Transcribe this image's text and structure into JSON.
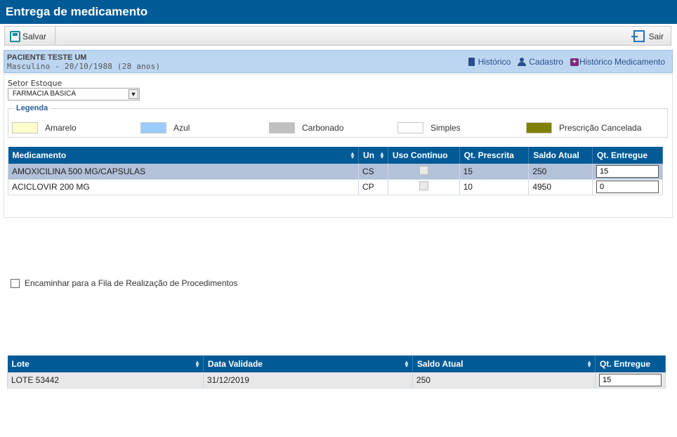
{
  "window": {
    "title": "Entrega de medicamento"
  },
  "toolbar": {
    "save_label": "Salvar",
    "exit_label": "Sair"
  },
  "patient": {
    "name": "PACIENTE TESTE UM",
    "info": "Masculino - 20/10/1988 (28 anos)",
    "links": {
      "historico": "Histórico",
      "cadastro": "Cadastro",
      "historico_medicamento": "Histórico Medicamento"
    }
  },
  "setor": {
    "label": "Setor Estoque",
    "value": "FARMACIA BASICA"
  },
  "legenda": {
    "title": "Legenda",
    "items": [
      {
        "label": "Amarelo",
        "color": "#ffffcc"
      },
      {
        "label": "Azul",
        "color": "#99ccff"
      },
      {
        "label": "Carbonado",
        "color": "#c0c0c0"
      },
      {
        "label": "Simples",
        "color": "#ffffff"
      },
      {
        "label": "Prescrição Cancelada",
        "color": "#808000"
      }
    ]
  },
  "medicamentos": {
    "columns": [
      "Medicamento",
      "Un",
      "Uso Contínuo",
      "Qt. Prescrita",
      "Saldo Atual",
      "Qt. Entregue"
    ],
    "rows": [
      {
        "medicamento": "AMOXICILINA 500 MG/CAPSULAS",
        "un": "CS",
        "qt_prescrita": "15",
        "saldo": "250",
        "qt_entregue": "15"
      },
      {
        "medicamento": "ACICLOVIR 200 MG",
        "un": "CP",
        "qt_prescrita": "10",
        "saldo": "4950",
        "qt_entregue": "0"
      }
    ]
  },
  "encaminhar": {
    "label": "Encaminhar para a Fila de Realização de Procedimentos"
  },
  "lotes": {
    "columns": [
      "Lote",
      "Data Validade",
      "Saldo Atual",
      "Qt. Entregue"
    ],
    "rows": [
      {
        "lote": "LOTE 53442",
        "validade": "31/12/2019",
        "saldo": "250",
        "qt_entregue": "15"
      }
    ]
  },
  "colors": {
    "header": "#005a96",
    "patient_bar": "#bcd6f2",
    "selected_row": "#b3c1d9"
  }
}
